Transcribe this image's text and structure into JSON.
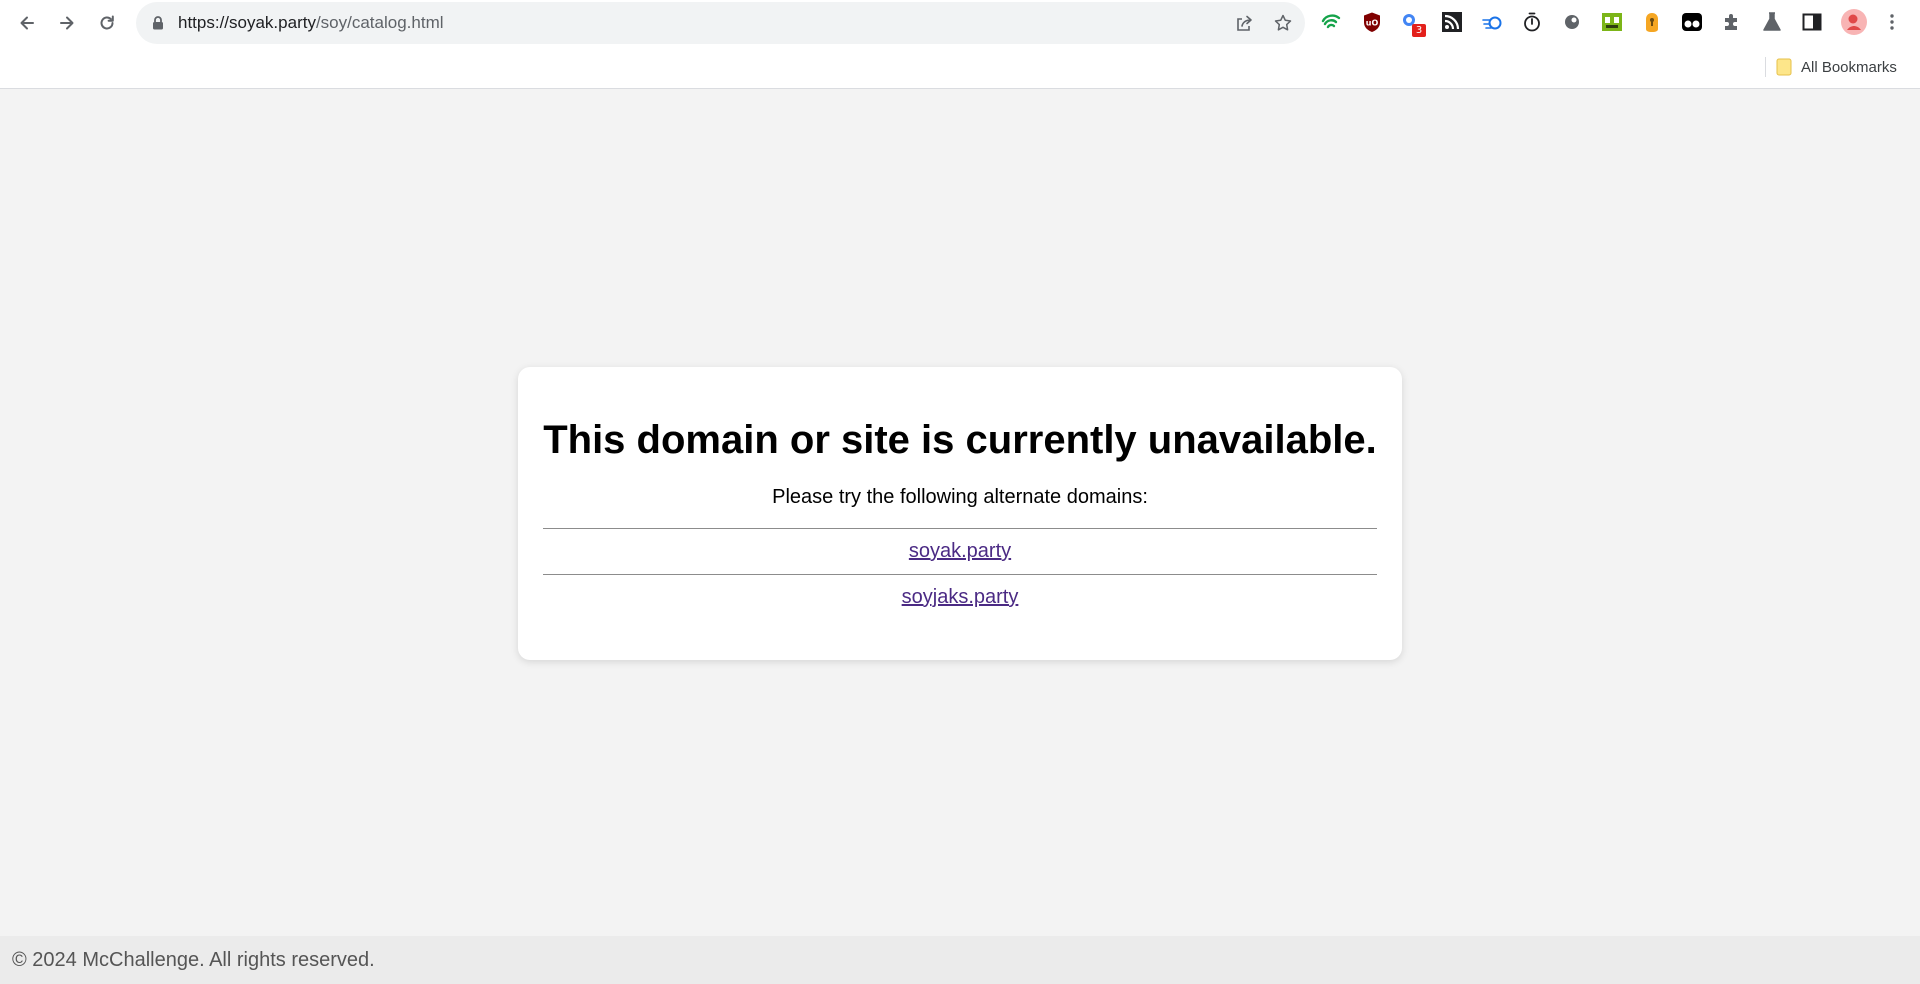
{
  "browser": {
    "url_host": "https://soyak.party",
    "url_path": "/soy/catalog.html",
    "bookmarks_label": "All Bookmarks",
    "extension_badge": "3",
    "extensions": [
      "guardian-shield-icon",
      "ublock-origin-icon",
      "notifier-icon",
      "rss-icon",
      "speed-dial-icon",
      "stopwatch-icon",
      "globe-icon",
      "gaming-icon",
      "keyhole-icon",
      "tampermonkey-icon",
      "puzzle-extensions-icon",
      "labs-flask-icon",
      "side-panel-icon"
    ]
  },
  "page": {
    "heading": "This domain or site is currently unavailable.",
    "subheading": "Please try the following alternate domains:",
    "domains": [
      "soyak.party",
      "soyjaks.party"
    ],
    "link_color": "#4b2a84"
  },
  "footer": {
    "text": "© 2024 McChallenge. All rights reserved."
  }
}
